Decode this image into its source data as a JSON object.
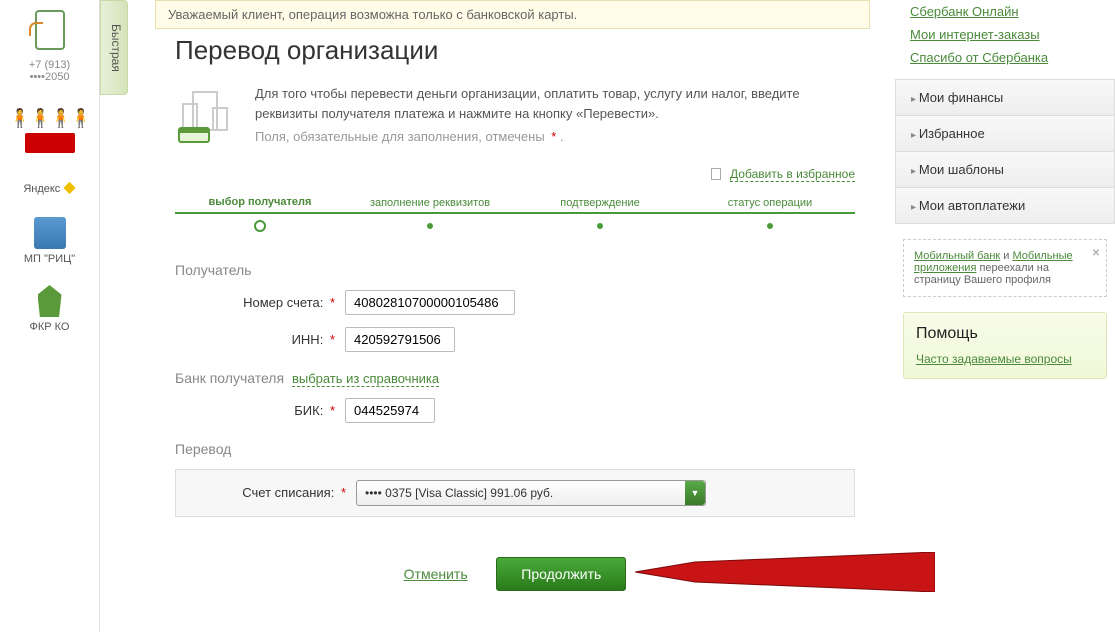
{
  "alert": "Уважаемый клиент, операция возможна только с банковской карты.",
  "sidebar_left": {
    "quick_tab": "Быстрая",
    "phone": "+7 (913) ••••2050",
    "items": [
      "",
      "Яндекс",
      "МП \"РИЦ\"",
      "ФКР КО"
    ]
  },
  "page": {
    "title": "Перевод организации",
    "intro": "Для того чтобы перевести деньги организации, оплатить товар, услугу или налог, введите реквизиты получателя платежа и нажмите на кнопку «Перевести».",
    "hint": "Поля, обязательные для заполнения, отмечены",
    "fav": "Добавить в избранное"
  },
  "steps": [
    "выбор получателя",
    "заполнение реквизитов",
    "подтверждение",
    "статус операции"
  ],
  "form": {
    "recipient_section": "Получатель",
    "account_label": "Номер счета:",
    "account_value": "40802810700000105486",
    "inn_label": "ИНН:",
    "inn_value": "420592791506",
    "bank_section": "Банк получателя",
    "bank_lookup": "выбрать из справочника",
    "bik_label": "БИК:",
    "bik_value": "044525974",
    "transfer_section": "Перевод",
    "debit_label": "Счет списания:",
    "debit_value": "•••• 0375 [Visa Classic] 991.06 руб."
  },
  "actions": {
    "cancel": "Отменить",
    "continue": "Продолжить"
  },
  "right": {
    "links": [
      "Сбербанк Онлайн",
      "Мои интернет-заказы",
      "Спасибо от Сбербанка"
    ],
    "menu": [
      "Мои финансы",
      "Избранное",
      "Мои шаблоны",
      "Мои автоплатежи"
    ],
    "info_a1": "Мобильный банк",
    "info_and": " и ",
    "info_a2": "Мобильные приложения",
    "info_rest": " переехали на страницу Вашего профиля",
    "help_title": "Помощь",
    "help_link": "Часто задаваемые вопросы"
  }
}
